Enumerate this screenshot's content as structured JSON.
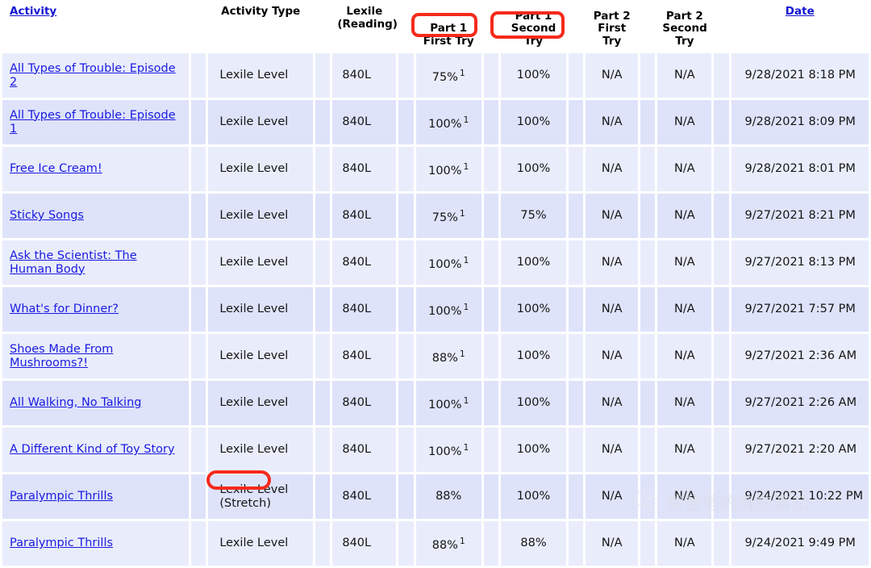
{
  "table": {
    "columns": [
      {
        "key": "activity",
        "label": "Activity",
        "link": true,
        "lines": [
          "Activity"
        ]
      },
      {
        "key": "activity_type",
        "label": "Activity Type",
        "link": false,
        "lines": [
          "Activity Type"
        ]
      },
      {
        "key": "lexile",
        "label": "Lexile (Reading)",
        "link": false,
        "lines": [
          "Lexile",
          "(Reading)"
        ]
      },
      {
        "key": "p1_first",
        "label": "Part 1 First Try",
        "link": false,
        "lines": [
          "Part 1",
          "First Try"
        ]
      },
      {
        "key": "p1_second",
        "label": "Part 1 Second Try",
        "link": false,
        "lines": [
          "Part 1",
          "Second Try"
        ]
      },
      {
        "key": "p2_first",
        "label": "Part 2 First Try",
        "link": false,
        "lines": [
          "Part 2",
          "First",
          "Try"
        ]
      },
      {
        "key": "p2_second",
        "label": "Part 2 Second Try",
        "link": false,
        "lines": [
          "Part 2",
          "Second",
          "Try"
        ]
      },
      {
        "key": "date",
        "label": "Date",
        "link": true,
        "lines": [
          "Date"
        ]
      }
    ],
    "header": {
      "activity": "Activity",
      "activity_type": "Activity Type",
      "lexile_l1": "Lexile",
      "lexile_l2": "(Reading)",
      "p1_l1": "Part 1",
      "p1_first_try": "First Try",
      "p1s_l1": "Part 1",
      "p1_second_try": "Second Try",
      "p2f_l1": "Part 2",
      "p2f_l2": "First",
      "p2f_l3": "Try",
      "p2s_l1": "Part 2",
      "p2s_l2": "Second",
      "p2s_l3": "Try",
      "date": "Date"
    },
    "rows": [
      {
        "activity": "All Types of Trouble: Episode 2",
        "activity_type": "Lexile Level",
        "activity_type_note": "",
        "lexile": "840L",
        "p1_first": "75%",
        "p1_first_marker": "1",
        "p1_second": "100%",
        "p2_first": "N/A",
        "p2_second": "N/A",
        "date": "9/28/2021  8:18 PM"
      },
      {
        "activity": "All Types of Trouble: Episode 1",
        "activity_type": "Lexile Level",
        "activity_type_note": "",
        "lexile": "840L",
        "p1_first": "100%",
        "p1_first_marker": "1",
        "p1_second": "100%",
        "p2_first": "N/A",
        "p2_second": "N/A",
        "date": "9/28/2021  8:09 PM"
      },
      {
        "activity": "Free Ice Cream!",
        "activity_type": "Lexile Level",
        "activity_type_note": "",
        "lexile": "840L",
        "p1_first": "100%",
        "p1_first_marker": "1",
        "p1_second": "100%",
        "p2_first": "N/A",
        "p2_second": "N/A",
        "date": "9/28/2021  8:01 PM"
      },
      {
        "activity": "Sticky Songs",
        "activity_type": "Lexile Level",
        "activity_type_note": "",
        "lexile": "840L",
        "p1_first": "75%",
        "p1_first_marker": "1",
        "p1_second": "75%",
        "p2_first": "N/A",
        "p2_second": "N/A",
        "date": "9/27/2021  8:21 PM"
      },
      {
        "activity": "Ask the Scientist: The Human Body",
        "activity_type": "Lexile Level",
        "activity_type_note": "",
        "lexile": "840L",
        "p1_first": "100%",
        "p1_first_marker": "1",
        "p1_second": "100%",
        "p2_first": "N/A",
        "p2_second": "N/A",
        "date": "9/27/2021  8:13 PM"
      },
      {
        "activity": "What's for Dinner?",
        "activity_type": "Lexile Level",
        "activity_type_note": "",
        "lexile": "840L",
        "p1_first": "100%",
        "p1_first_marker": "1",
        "p1_second": "100%",
        "p2_first": "N/A",
        "p2_second": "N/A",
        "date": "9/27/2021  7:57 PM"
      },
      {
        "activity": "Shoes Made From Mushrooms?!",
        "activity_type": "Lexile Level",
        "activity_type_note": "",
        "lexile": "840L",
        "p1_first": "88%",
        "p1_first_marker": "1",
        "p1_second": "100%",
        "p2_first": "N/A",
        "p2_second": "N/A",
        "date": "9/27/2021  2:36 AM"
      },
      {
        "activity": "All Walking, No Talking",
        "activity_type": "Lexile Level",
        "activity_type_note": "",
        "lexile": "840L",
        "p1_first": "100%",
        "p1_first_marker": "1",
        "p1_second": "100%",
        "p2_first": "N/A",
        "p2_second": "N/A",
        "date": "9/27/2021  2:26 AM"
      },
      {
        "activity": "A Different Kind of Toy Story",
        "activity_type": "Lexile Level",
        "activity_type_note": "",
        "lexile": "840L",
        "p1_first": "100%",
        "p1_first_marker": "1",
        "p1_second": "100%",
        "p2_first": "N/A",
        "p2_second": "N/A",
        "date": "9/27/2021  2:20 AM"
      },
      {
        "activity": "Paralympic Thrills",
        "activity_type": "Lexile Level",
        "activity_type_note": "(Stretch)",
        "lexile": "840L",
        "p1_first": "88%",
        "p1_first_marker": "",
        "p1_second": "100%",
        "p2_first": "N/A",
        "p2_second": "N/A",
        "date": "9/24/2021 10:22 PM"
      },
      {
        "activity": "Paralympic Thrills",
        "activity_type": "Lexile Level",
        "activity_type_note": "",
        "lexile": "840L",
        "p1_first": "88%",
        "p1_first_marker": "1",
        "p1_second": "88%",
        "p2_first": "N/A",
        "p2_second": "N/A",
        "date": "9/24/2021  9:49 PM"
      }
    ]
  },
  "annotations": {
    "color": "#f62a1c",
    "items": [
      {
        "name": "first-try-highlight",
        "target": "First Try"
      },
      {
        "name": "second-try-highlight",
        "target": "Second Try"
      },
      {
        "name": "stretch-highlight",
        "target": "(Stretch)"
      }
    ]
  },
  "watermark": {
    "text": "胖爸爸的鸡娃笔记",
    "icon": "wechat-icon"
  },
  "colors": {
    "row_light": "#e9edfb",
    "row_dark": "#dee3fa",
    "link": "#1a1ae0",
    "header_link": "#1414d2",
    "annotation_red": "#f62a1c",
    "page_background": "#ffffff"
  }
}
